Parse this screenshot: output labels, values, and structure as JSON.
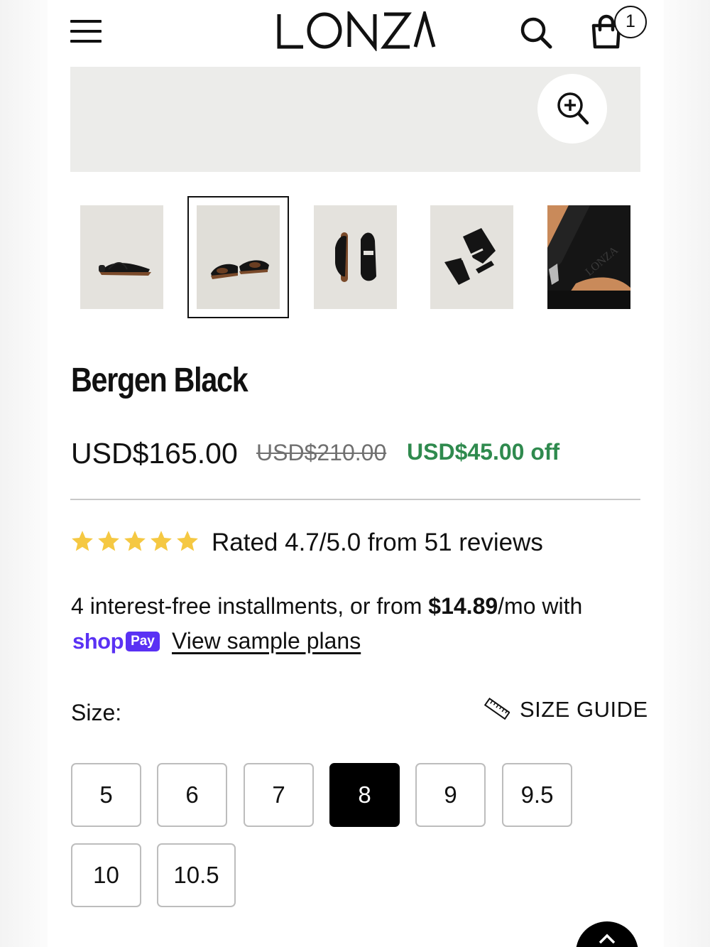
{
  "header": {
    "brand": "LONZA",
    "cart_count": "1"
  },
  "gallery": {
    "thumbnails": [
      {
        "name": "side view"
      },
      {
        "name": "pair front view",
        "selected": true
      },
      {
        "name": "top view pair"
      },
      {
        "name": "angled top view"
      },
      {
        "name": "insole detail"
      }
    ],
    "thumbnail_logo_text": "LONZA"
  },
  "product": {
    "title": "Bergen Black",
    "price_current": "USD$165.00",
    "price_original": "USD$210.00",
    "discount": "USD$45.00 off"
  },
  "rating": {
    "stars": 5,
    "text": "Rated 4.7/5.0 from 51 reviews",
    "star_color": "#f5c842"
  },
  "installments": {
    "prefix": "4 interest-free installments, or from ",
    "amount": "$14.89",
    "suffix": "/mo with",
    "shop_word": "shop",
    "pay_badge": "Pay",
    "link": "View sample plans",
    "brand_color": "#5a31f4"
  },
  "size": {
    "label": "Size:",
    "guide": "SIZE GUIDE",
    "options": [
      "5",
      "6",
      "7",
      "8",
      "9",
      "9.5",
      "10",
      "10.5"
    ],
    "selected": "8"
  },
  "colors": {
    "discount_green": "#2f8a4e",
    "selected_size_bg": "#000000"
  }
}
